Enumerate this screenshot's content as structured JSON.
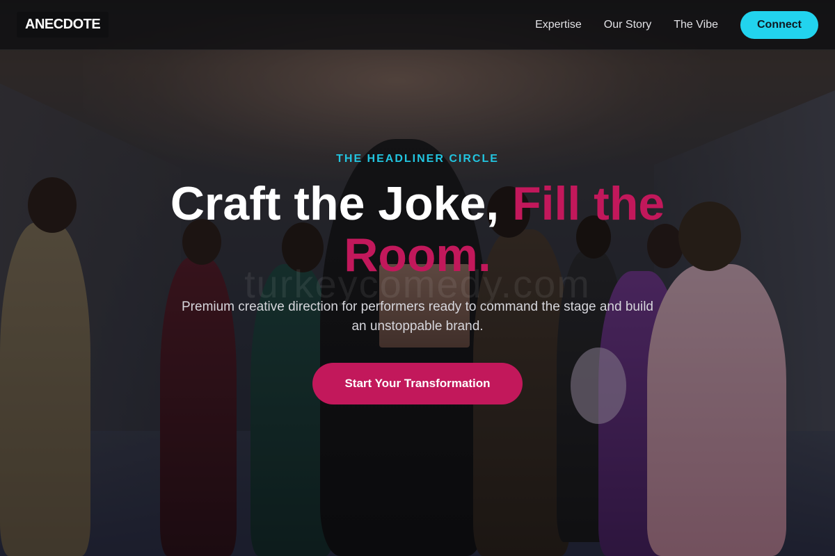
{
  "header": {
    "logo": "ANECDOTE",
    "nav": [
      "Expertise",
      "Our Story",
      "The Vibe"
    ],
    "connect_label": "Connect"
  },
  "hero": {
    "eyebrow": "THE HEADLINER CIRCLE",
    "headline_white": "Craft the Joke, ",
    "headline_accent": "Fill the Room.",
    "watermark": "turkeycomedy.com",
    "subtitle": "Premium creative direction for performers ready to command the stage and build an unstoppable brand.",
    "cta_label": "Start Your Transformation"
  },
  "colors": {
    "accent_cyan": "#22d3ee",
    "accent_magenta": "#c2185b",
    "header_bg": "#101012"
  }
}
